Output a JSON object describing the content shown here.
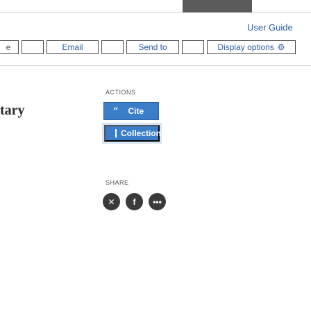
{
  "header": {
    "user_guide": "User Guide"
  },
  "toolbar": {
    "frag_left": "e",
    "email": "Email",
    "send_to": "Send to",
    "display_options": "Display options",
    "gear_icon": "gear-icon"
  },
  "article": {
    "title_fragment": "tary"
  },
  "actions": {
    "label": "ACTIONS",
    "cite": "Cite",
    "collections": "Collections"
  },
  "share": {
    "label": "SHARE",
    "icons": [
      "x-twitter-icon",
      "facebook-icon",
      "more-icon"
    ]
  },
  "colors": {
    "accent": "#3a7dc9",
    "link": "#2b5fa4",
    "icon_bg": "#3a3a3a"
  }
}
